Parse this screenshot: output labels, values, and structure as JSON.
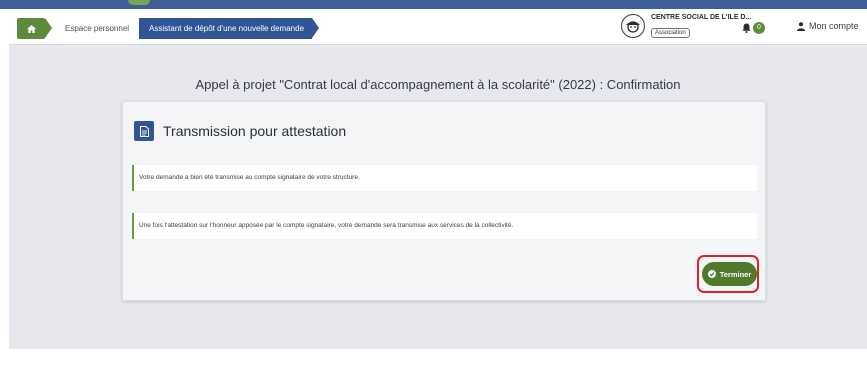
{
  "breadcrumb": {
    "home_icon": "home-icon",
    "personal_space": "Espace personnel",
    "current": "Assistant de dépôt d'une nouvelle demande"
  },
  "organization": {
    "name": "CENTRE SOCIAL DE L'ILE D...",
    "type": "Association",
    "logo_icon": "organization-logo"
  },
  "notifications": {
    "icon": "bell-icon",
    "count": "0"
  },
  "account": {
    "icon": "user-icon",
    "label": "Mon compte"
  },
  "page": {
    "title": "Appel à projet \"Contrat local d'accompagnement à la scolarité\" (2022) : Confirmation"
  },
  "card": {
    "icon": "document-icon",
    "title": "Transmission pour attestation",
    "message_1": "Votre demande a bien été transmise au compte signataire de votre structure.",
    "message_2": "Une fois l'attestation sur l'honneur apposée par le compte signataire, votre demande sera transmise aux services de la collectivité.",
    "finish_button": "Terminer"
  },
  "colors": {
    "primary_blue": "#2f5597",
    "accent_green": "#4f7a2e",
    "highlight_red": "#e0202a"
  }
}
